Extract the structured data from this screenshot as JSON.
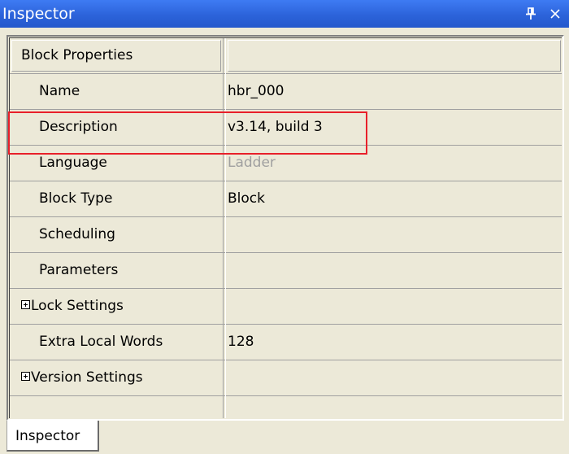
{
  "window": {
    "title": "Inspector",
    "pin_icon": "pin-icon",
    "close_icon": "close-icon"
  },
  "grid": {
    "category": "Block Properties",
    "rows": [
      {
        "name": "Name",
        "value": "hbr_000",
        "enabled": true
      },
      {
        "name": "Description",
        "value": "v3.14, build 3",
        "enabled": true
      },
      {
        "name": "Language",
        "value": "Ladder",
        "enabled": false
      },
      {
        "name": "Block Type",
        "value": "Block",
        "enabled": true
      },
      {
        "name": "Scheduling",
        "value": "",
        "enabled": true
      },
      {
        "name": "Parameters",
        "value": "",
        "enabled": true
      },
      {
        "name": "Lock Settings",
        "value": "",
        "expandable": true
      },
      {
        "name": "Extra Local Words",
        "value": "128",
        "enabled": true
      },
      {
        "name": "Version Settings",
        "value": "",
        "expandable": true
      }
    ]
  },
  "tabs": [
    {
      "label": "Inspector",
      "active": true
    }
  ],
  "colors": {
    "titlebar": "#2C63DA",
    "highlight": "#E8202A",
    "disabled_text": "#A0A0A0",
    "background": "#ECE9D8"
  }
}
